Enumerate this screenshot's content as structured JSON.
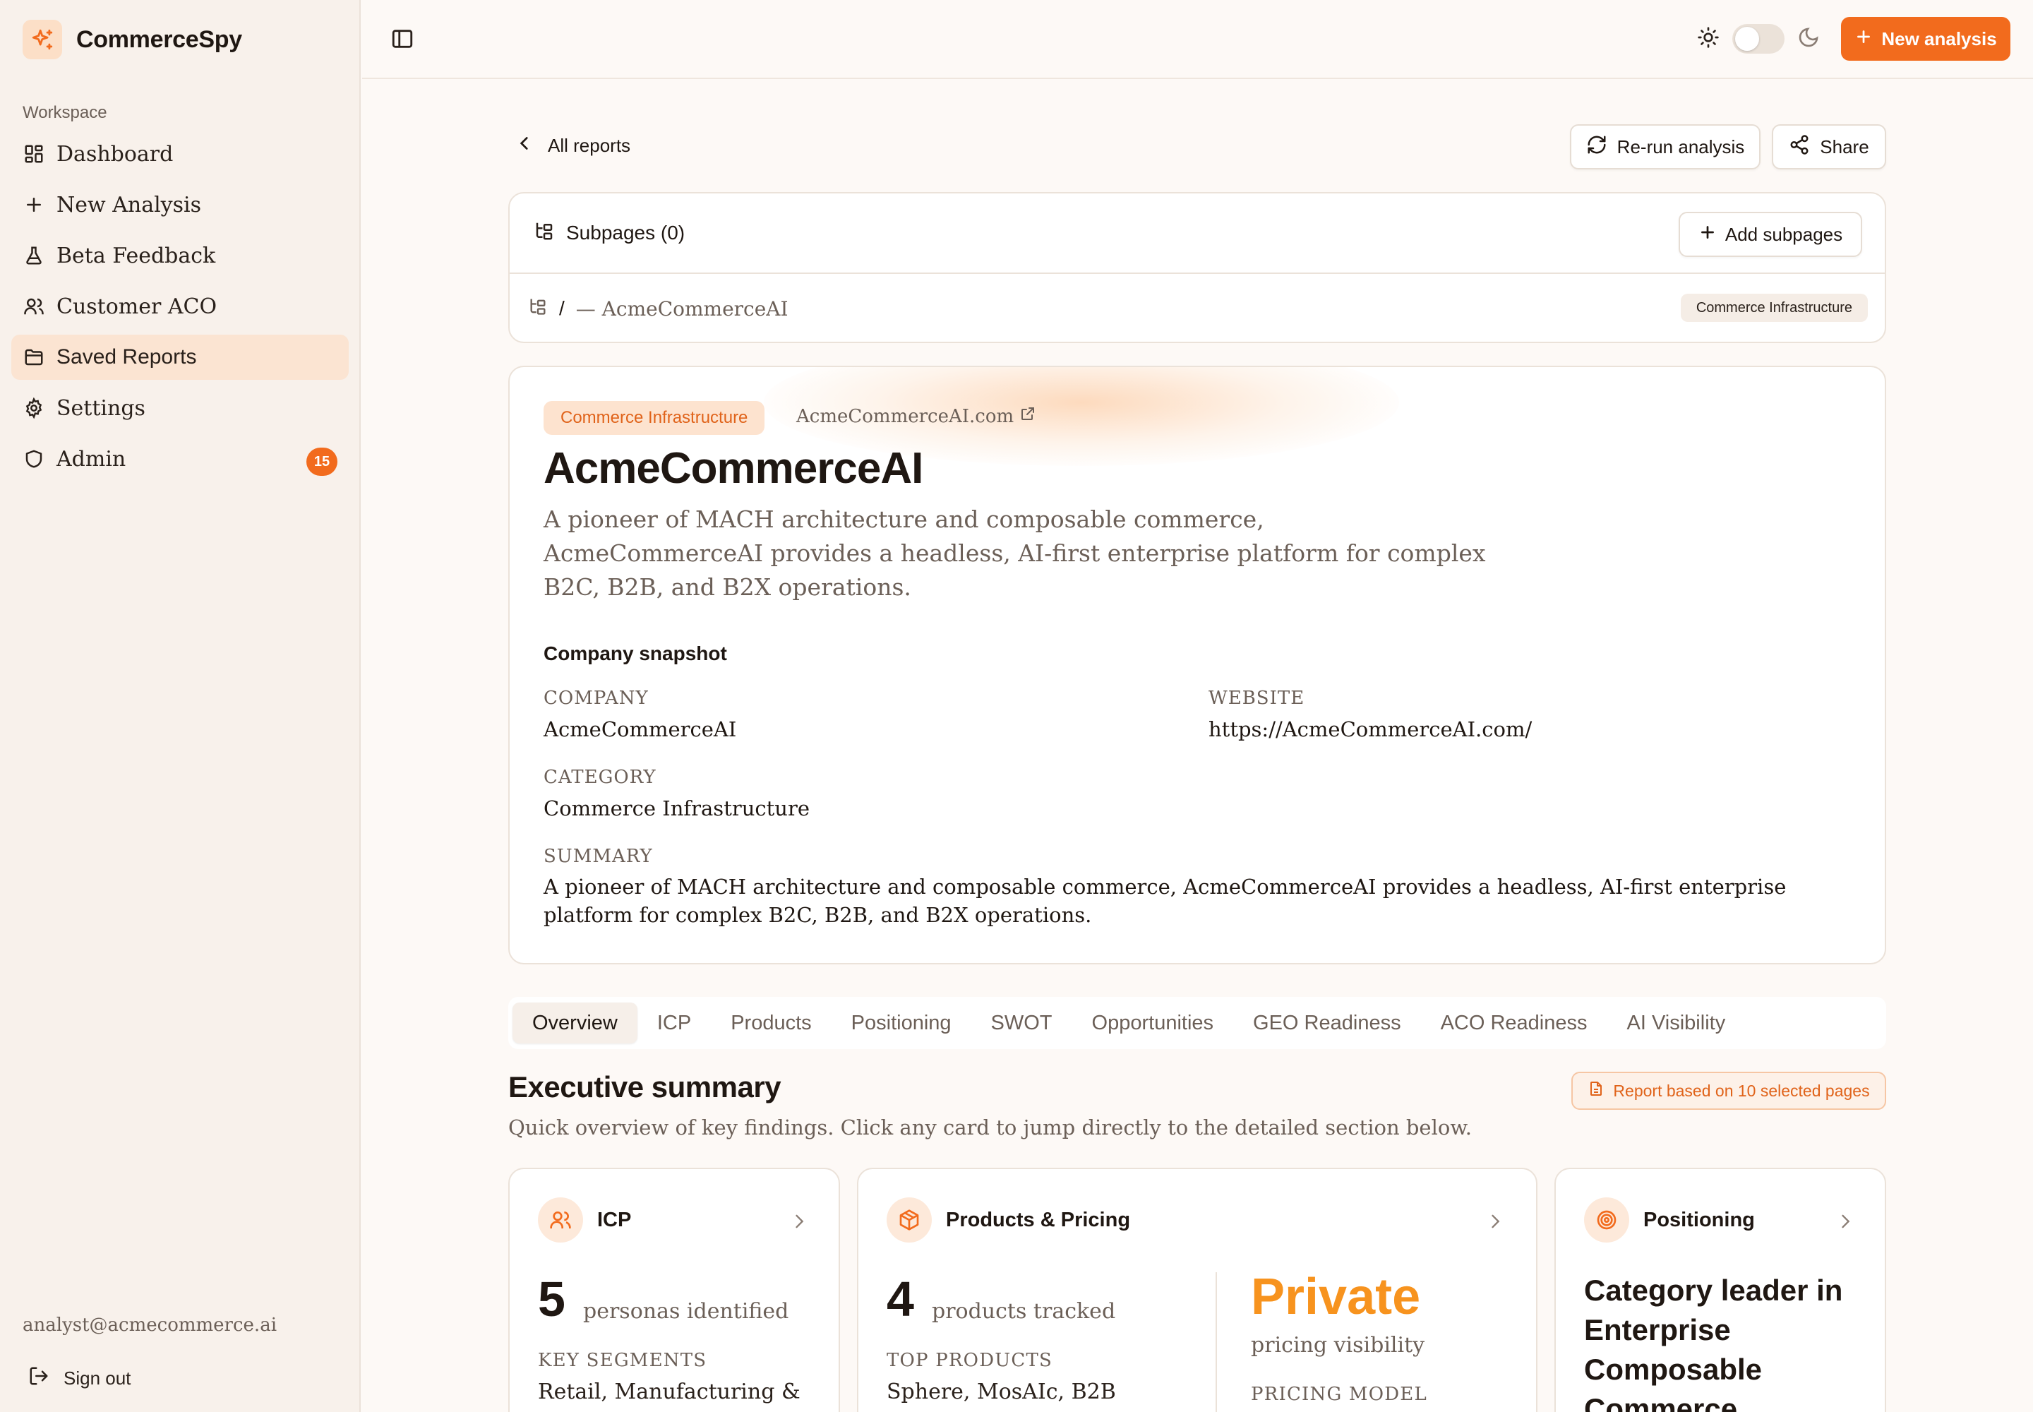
{
  "app": {
    "name": "CommerceSpy"
  },
  "sidebar": {
    "section_label": "Workspace",
    "items": [
      {
        "label": "Dashboard",
        "icon": "dashboard-icon"
      },
      {
        "label": "New Analysis",
        "icon": "plus-icon"
      },
      {
        "label": "Beta Feedback",
        "icon": "flask-icon"
      },
      {
        "label": "Customer ACO",
        "icon": "users-icon"
      },
      {
        "label": "Saved Reports",
        "icon": "folder-icon",
        "active": true
      },
      {
        "label": "Settings",
        "icon": "gear-icon"
      },
      {
        "label": "Admin",
        "icon": "shield-icon",
        "badge": "15"
      }
    ],
    "user_email": "analyst@acmecommerce.ai",
    "signout_label": "Sign out"
  },
  "topbar": {
    "new_analysis_label": "New analysis"
  },
  "toolbar": {
    "back_label": "All reports",
    "rerun_label": "Re-run analysis",
    "share_label": "Share"
  },
  "subpages": {
    "title": "Subpages (0)",
    "add_label": "Add subpages",
    "crumb_sep": "/",
    "crumb_current": "— AcmeCommerceAI",
    "category_tag": "Commerce Infrastructure"
  },
  "company": {
    "category": "Commerce Infrastructure",
    "website_display": "AcmeCommerceAI.com",
    "name": "AcmeCommerceAI",
    "description": "A pioneer of MACH architecture and composable commerce, AcmeCommerceAI provides a headless, AI-first enterprise platform for complex B2C, B2B, and B2X operations.",
    "snapshot_title": "Company snapshot",
    "fields": {
      "company_label": "COMPANY",
      "company_value": "AcmeCommerceAI",
      "website_label": "WEBSITE",
      "website_value": "https://AcmeCommerceAI.com/",
      "category_label": "CATEGORY",
      "category_value": "Commerce Infrastructure",
      "summary_label": "SUMMARY",
      "summary_value": "A pioneer of MACH architecture and composable commerce, AcmeCommerceAI provides a headless, AI-first enterprise platform for complex B2C, B2B, and B2X operations."
    }
  },
  "tabs": [
    "Overview",
    "ICP",
    "Products",
    "Positioning",
    "SWOT",
    "Opportunities",
    "GEO Readiness",
    "ACO Readiness",
    "AI Visibility"
  ],
  "executive": {
    "title": "Executive summary",
    "subtitle": "Quick overview of key findings. Click any card to jump directly to the detailed section below.",
    "report_note": "Report based on 10 selected pages"
  },
  "cards": {
    "icp": {
      "title": "ICP",
      "count": "5",
      "unit": "personas identified",
      "segments_label": "KEY SEGMENTS",
      "segments_value": "Retail, Manufacturing &"
    },
    "products": {
      "title": "Products & Pricing",
      "count": "4",
      "unit": "products tracked",
      "top_label": "TOP PRODUCTS",
      "top_value": "Sphere, MosAIc, B2B",
      "pricing_value": "Private",
      "pricing_unit": "pricing visibility",
      "model_label": "PRICING MODEL"
    },
    "positioning": {
      "title": "Positioning",
      "statement": "Category leader in Enterprise Composable Commerce"
    }
  },
  "colors": {
    "accent": "#f26b1d",
    "accent_soft": "#fde3cf",
    "private": "#f7931e"
  }
}
